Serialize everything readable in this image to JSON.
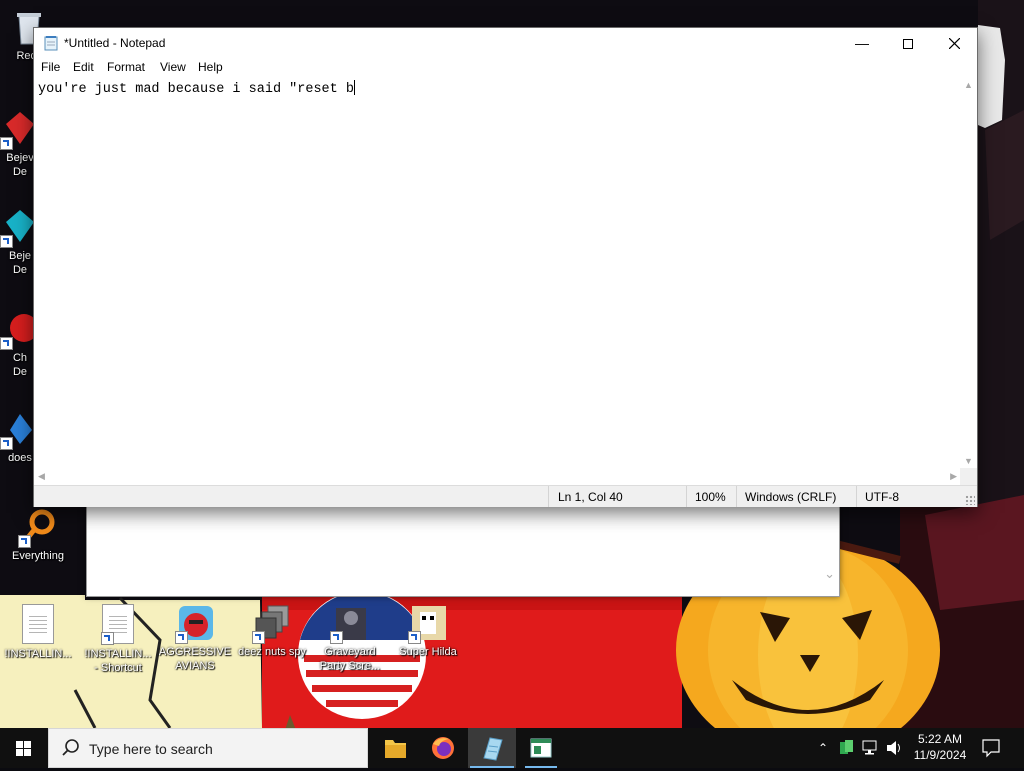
{
  "desktop": {
    "icons": [
      {
        "label": "Recy"
      },
      {
        "label": "Bejev\nDe"
      },
      {
        "label": "Beje\nDe"
      },
      {
        "label": "Ch\nDe"
      },
      {
        "label": "does"
      },
      {
        "label": "Everything"
      },
      {
        "label": "!INSTALLIN..."
      },
      {
        "label": "!INSTALLIN...\n- Shortcut"
      },
      {
        "label": "AGGRESSIVE\nAVIANS"
      },
      {
        "label": "deez nuts spy"
      },
      {
        "label": "Graveyard\nParty Scre..."
      },
      {
        "label": "Super Hilda"
      }
    ]
  },
  "notepad": {
    "title": "*Untitled - Notepad",
    "menu": [
      "File",
      "Edit",
      "Format",
      "View",
      "Help"
    ],
    "content": "you're just mad because i said \"reset b",
    "status": {
      "position": "Ln 1, Col 40",
      "zoom": "100%",
      "line_ending": "Windows (CRLF)",
      "encoding": "UTF-8"
    }
  },
  "taskbar": {
    "search_placeholder": "Type here to search",
    "time": "5:22 AM",
    "date": "11/9/2024"
  }
}
